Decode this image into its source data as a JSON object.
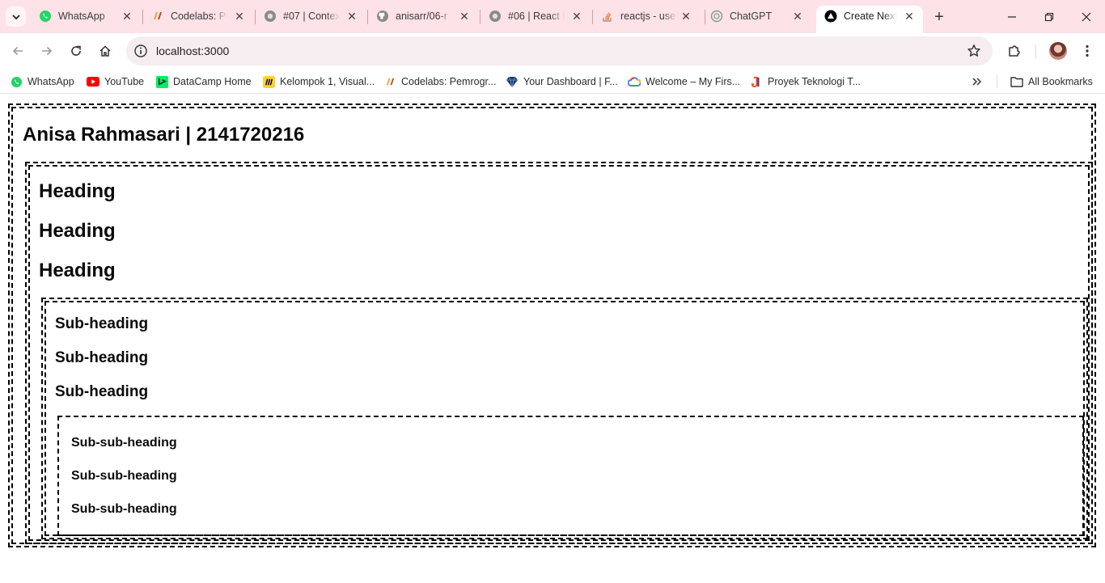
{
  "tabs": [
    {
      "title": "WhatsApp",
      "icon": "whatsapp-icon",
      "active": false
    },
    {
      "title": "Codelabs: Pe",
      "icon": "codelabs-icon",
      "active": false
    },
    {
      "title": "#07 | Contex",
      "icon": "globe-icon",
      "active": false
    },
    {
      "title": "anisarr/06-r",
      "icon": "github-icon",
      "active": false
    },
    {
      "title": "#06 | React I",
      "icon": "globe-icon",
      "active": false
    },
    {
      "title": "reactjs - use",
      "icon": "stackoverflow-icon",
      "active": false
    },
    {
      "title": "ChatGPT",
      "icon": "chatgpt-icon",
      "active": false
    },
    {
      "title": "Create Next",
      "icon": "nextjs-icon",
      "active": true
    }
  ],
  "address_bar": {
    "url": "localhost:3000"
  },
  "bookmarks": [
    {
      "label": "WhatsApp",
      "icon": "whatsapp-icon"
    },
    {
      "label": "YouTube",
      "icon": "youtube-icon"
    },
    {
      "label": "DataCamp Home",
      "icon": "datacamp-icon"
    },
    {
      "label": "Kelompok 1, Visual...",
      "icon": "miro-icon"
    },
    {
      "label": "Codelabs: Pemrogr...",
      "icon": "codelabs-icon"
    },
    {
      "label": "Your Dashboard | F...",
      "icon": "diamond-icon"
    },
    {
      "label": "Welcome – My Firs...",
      "icon": "cloud-icon"
    },
    {
      "label": "Proyek Teknologi T...",
      "icon": "jti-icon"
    }
  ],
  "all_bookmarks_label": "All Bookmarks",
  "page": {
    "title": "Anisa Rahmasari | 2141720216",
    "headings": [
      "Heading",
      "Heading",
      "Heading"
    ],
    "subheadings": [
      "Sub-heading",
      "Sub-heading",
      "Sub-heading"
    ],
    "subsubheadings": [
      "Sub-sub-heading",
      "Sub-sub-heading",
      "Sub-sub-heading"
    ]
  },
  "colors": {
    "tabstrip_bg": "#fde2e7",
    "border": "#000000"
  }
}
